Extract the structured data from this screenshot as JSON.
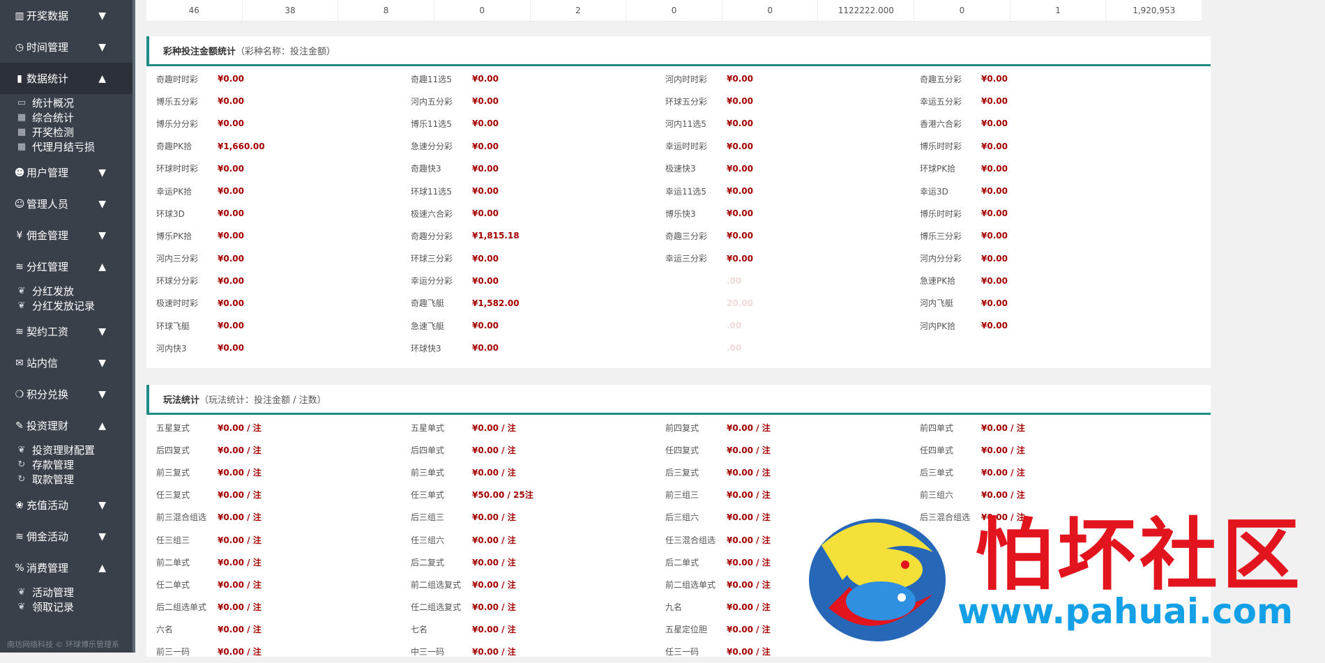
{
  "sidebar": {
    "menus": [
      {
        "label": "开奖数据",
        "icon": "bar-chart-icon",
        "expanded": false,
        "children": []
      },
      {
        "label": "时间管理",
        "icon": "clock-icon",
        "expanded": false,
        "children": []
      },
      {
        "label": "数据统计",
        "icon": "stats-icon",
        "expanded": true,
        "active": true,
        "children": [
          {
            "label": "统计概况",
            "icon": "monitor-icon"
          },
          {
            "label": "综合统计",
            "icon": "building-icon"
          },
          {
            "label": "开奖检测",
            "icon": "building-icon"
          },
          {
            "label": "代理月结亏损",
            "icon": "building-icon"
          }
        ]
      },
      {
        "label": "用户管理",
        "icon": "users-icon",
        "expanded": false,
        "children": []
      },
      {
        "label": "管理人员",
        "icon": "user-icon",
        "expanded": false,
        "children": []
      },
      {
        "label": "佣金管理",
        "icon": "yen-icon",
        "expanded": false,
        "children": []
      },
      {
        "label": "分红管理",
        "icon": "database-icon",
        "expanded": true,
        "children": [
          {
            "label": "分红发放",
            "icon": "leaf-icon"
          },
          {
            "label": "分红发放记录",
            "icon": "leaf-icon"
          }
        ]
      },
      {
        "label": "契约工资",
        "icon": "database-icon",
        "expanded": false,
        "children": []
      },
      {
        "label": "站内信",
        "icon": "envelope-icon",
        "expanded": false,
        "children": []
      },
      {
        "label": "积分兑换",
        "icon": "money-bag-icon",
        "expanded": false,
        "children": []
      },
      {
        "label": "投资理财",
        "icon": "edit-icon",
        "expanded": true,
        "children": [
          {
            "label": "投资理财配置",
            "icon": "leaf-icon"
          },
          {
            "label": "存款管理",
            "icon": "refresh-icon"
          },
          {
            "label": "取款管理",
            "icon": "refresh-icon"
          }
        ]
      },
      {
        "label": "充值活动",
        "icon": "gift-icon",
        "expanded": false,
        "children": []
      },
      {
        "label": "佣金活动",
        "icon": "database-icon",
        "expanded": false,
        "children": []
      },
      {
        "label": "消费管理",
        "icon": "percent-icon",
        "expanded": true,
        "children": [
          {
            "label": "活动管理",
            "icon": "leaf-icon"
          },
          {
            "label": "领取记录",
            "icon": "leaf-icon"
          }
        ]
      }
    ],
    "footer": "南坊网络科技 © 环球博乐管理系"
  },
  "top_row": [
    "46",
    "38",
    "8",
    "0",
    "2",
    "0",
    "0",
    "1122222.000",
    "0",
    "1",
    "1,920,953"
  ],
  "lottery_panel": {
    "title": "彩种投注金额统计",
    "subtitle": "（彩种名称：投注金额）",
    "rows": [
      [
        {
          "label": "奇趣时时彩",
          "value": "¥0.00"
        },
        {
          "label": "奇趣11选5",
          "value": "¥0.00"
        },
        {
          "label": "河内时时彩",
          "value": "¥0.00"
        },
        {
          "label": "奇趣五分彩",
          "value": "¥0.00"
        }
      ],
      [
        {
          "label": "博乐五分彩",
          "value": "¥0.00"
        },
        {
          "label": "河内五分彩",
          "value": "¥0.00"
        },
        {
          "label": "环球五分彩",
          "value": "¥0.00"
        },
        {
          "label": "幸运五分彩",
          "value": "¥0.00"
        }
      ],
      [
        {
          "label": "博乐分分彩",
          "value": "¥0.00"
        },
        {
          "label": "博乐11选5",
          "value": "¥0.00"
        },
        {
          "label": "河内11选5",
          "value": "¥0.00"
        },
        {
          "label": "香港六合彩",
          "value": "¥0.00"
        }
      ],
      [
        {
          "label": "奇趣PK拾",
          "value": "¥1,660.00"
        },
        {
          "label": "急速分分彩",
          "value": "¥0.00"
        },
        {
          "label": "幸运时时彩",
          "value": "¥0.00"
        },
        {
          "label": "博乐时时彩",
          "value": "¥0.00"
        }
      ],
      [
        {
          "label": "环球时时彩",
          "value": "¥0.00"
        },
        {
          "label": "奇趣快3",
          "value": "¥0.00"
        },
        {
          "label": "极速快3",
          "value": "¥0.00"
        },
        {
          "label": "环球PK拾",
          "value": "¥0.00"
        }
      ],
      [
        {
          "label": "幸运PK拾",
          "value": "¥0.00"
        },
        {
          "label": "环球11选5",
          "value": "¥0.00"
        },
        {
          "label": "幸运11选5",
          "value": "¥0.00"
        },
        {
          "label": "幸运3D",
          "value": "¥0.00"
        }
      ],
      [
        {
          "label": "环球3D",
          "value": "¥0.00"
        },
        {
          "label": "极速六合彩",
          "value": "¥0.00"
        },
        {
          "label": "博乐快3",
          "value": "¥0.00"
        },
        {
          "label": "博乐时时彩",
          "value": "¥0.00"
        }
      ],
      [
        {
          "label": "博乐PK拾",
          "value": "¥0.00"
        },
        {
          "label": "奇趣分分彩",
          "value": "¥1,815.18"
        },
        {
          "label": "奇趣三分彩",
          "value": "¥0.00"
        },
        {
          "label": "博乐三分彩",
          "value": "¥0.00"
        }
      ],
      [
        {
          "label": "河内三分彩",
          "value": "¥0.00"
        },
        {
          "label": "环球三分彩",
          "value": "¥0.00"
        },
        {
          "label": "幸运三分彩",
          "value": "¥0.00"
        },
        {
          "label": "河内分分彩",
          "value": "¥0.00"
        }
      ],
      [
        {
          "label": "环球分分彩",
          "value": "¥0.00"
        },
        {
          "label": "幸运分分彩",
          "value": "¥0.00"
        },
        {
          "label": "",
          "value": ".00"
        },
        {
          "label": "急速PK拾",
          "value": "¥0.00"
        }
      ],
      [
        {
          "label": "极速时时彩",
          "value": "¥0.00"
        },
        {
          "label": "奇趣飞艇",
          "value": "¥1,582.00"
        },
        {
          "label": "",
          "value": "20.00"
        },
        {
          "label": "河内飞艇",
          "value": "¥0.00"
        }
      ],
      [
        {
          "label": "环球飞艇",
          "value": "¥0.00"
        },
        {
          "label": "急速飞艇",
          "value": "¥0.00"
        },
        {
          "label": "",
          "value": ".00"
        },
        {
          "label": "河内PK拾",
          "value": "¥0.00"
        }
      ],
      [
        {
          "label": "河内快3",
          "value": "¥0.00"
        },
        {
          "label": "环球快3",
          "value": "¥0.00"
        },
        {
          "label": "",
          "value": ".00"
        },
        {
          "label": "",
          "value": ""
        }
      ]
    ]
  },
  "play_panel": {
    "title": "玩法统计",
    "subtitle": "（玩法统计：投注金额 / 注数）",
    "rows": [
      [
        {
          "label": "五星复式",
          "value": "¥0.00 / 注"
        },
        {
          "label": "五星单式",
          "value": "¥0.00 / 注"
        },
        {
          "label": "前四复式",
          "value": "¥0.00 / 注"
        },
        {
          "label": "前四单式",
          "value": "¥0.00 / 注"
        }
      ],
      [
        {
          "label": "后四复式",
          "value": "¥0.00 / 注"
        },
        {
          "label": "后四单式",
          "value": "¥0.00 / 注"
        },
        {
          "label": "任四复式",
          "value": "¥0.00 / 注"
        },
        {
          "label": "任四单式",
          "value": "¥0.00 / 注"
        }
      ],
      [
        {
          "label": "前三复式",
          "value": "¥0.00 / 注"
        },
        {
          "label": "前三单式",
          "value": "¥0.00 / 注"
        },
        {
          "label": "后三复式",
          "value": "¥0.00 / 注"
        },
        {
          "label": "后三单式",
          "value": "¥0.00 / 注"
        }
      ],
      [
        {
          "label": "任三复式",
          "value": "¥0.00 / 注"
        },
        {
          "label": "任三单式",
          "value": "¥50.00 / 25注"
        },
        {
          "label": "前三组三",
          "value": "¥0.00 / 注"
        },
        {
          "label": "前三组六",
          "value": "¥0.00 / 注"
        }
      ],
      [
        {
          "label": "前三混合组选",
          "value": "¥0.00 / 注"
        },
        {
          "label": "后三组三",
          "value": "¥0.00 / 注"
        },
        {
          "label": "后三组六",
          "value": "¥0.00 / 注"
        },
        {
          "label": "后三混合组选",
          "value": "¥0.00 / 注"
        }
      ],
      [
        {
          "label": "任三组三",
          "value": "¥0.00 / 注"
        },
        {
          "label": "任三组六",
          "value": "¥0.00 / 注"
        },
        {
          "label": "任三混合组选",
          "value": "¥0.00 / 注"
        },
        {
          "label": "",
          "value": ""
        }
      ],
      [
        {
          "label": "前二单式",
          "value": "¥0.00 / 注"
        },
        {
          "label": "后二复式",
          "value": "¥0.00 / 注"
        },
        {
          "label": "后二单式",
          "value": "¥0.00 / 注"
        },
        {
          "label": "",
          "value": ""
        }
      ],
      [
        {
          "label": "任二单式",
          "value": "¥0.00 / 注"
        },
        {
          "label": "前二组选复式",
          "value": "¥0.00 / 注"
        },
        {
          "label": "前二组选单式",
          "value": "¥0.00 / 注"
        },
        {
          "label": "",
          "value": ""
        }
      ],
      [
        {
          "label": "后二组选单式",
          "value": "¥0.00 / 注"
        },
        {
          "label": "任二组选复式",
          "value": "¥0.00 / 注"
        },
        {
          "label": "九名",
          "value": "¥0.00 / 注"
        },
        {
          "label": "",
          "value": ""
        }
      ],
      [
        {
          "label": "六名",
          "value": "¥0.00 / 注"
        },
        {
          "label": "七名",
          "value": "¥0.00 / 注"
        },
        {
          "label": "五星定位胆",
          "value": "¥0.00 / 注"
        },
        {
          "label": "",
          "value": ""
        }
      ],
      [
        {
          "label": "前三一码",
          "value": "¥0.00 / 注"
        },
        {
          "label": "中三一码",
          "value": "¥0.00 / 注"
        },
        {
          "label": "任三一码",
          "value": "¥0.00 / 注"
        },
        {
          "label": "",
          "value": ""
        }
      ]
    ]
  },
  "watermark": {
    "text": "怕坏社区",
    "url": "www.pahuai.com"
  }
}
